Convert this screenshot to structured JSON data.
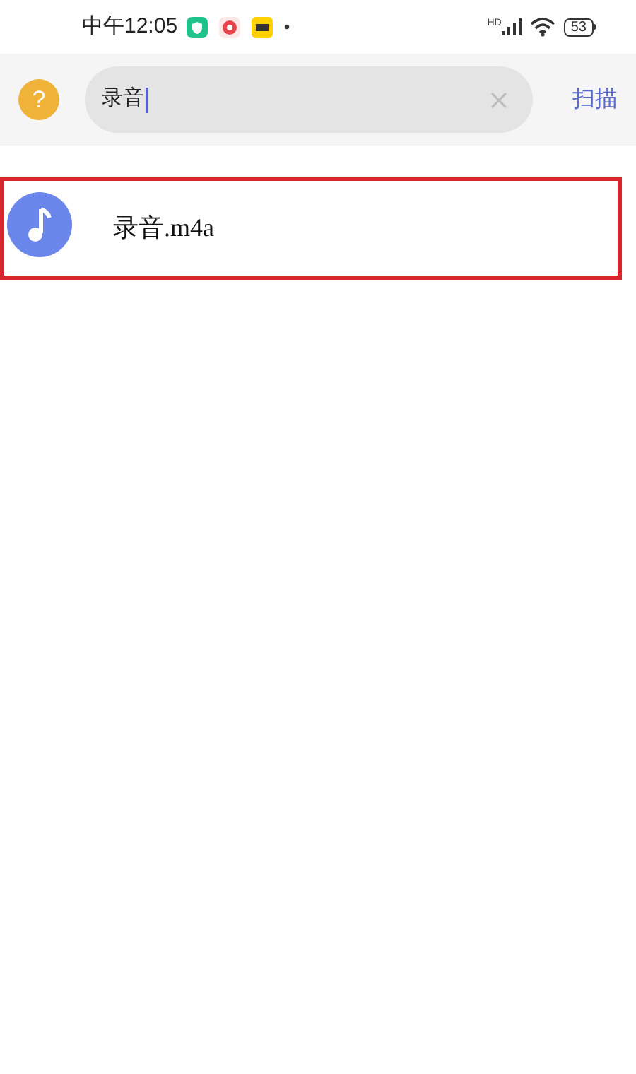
{
  "status_bar": {
    "time": "中午12:05",
    "network": "HD",
    "battery": "53"
  },
  "header": {
    "help": "?",
    "search": {
      "value": "录音"
    },
    "scan_button": "扫描"
  },
  "results": [
    {
      "name": "录音.m4a",
      "highlighted": true
    }
  ]
}
